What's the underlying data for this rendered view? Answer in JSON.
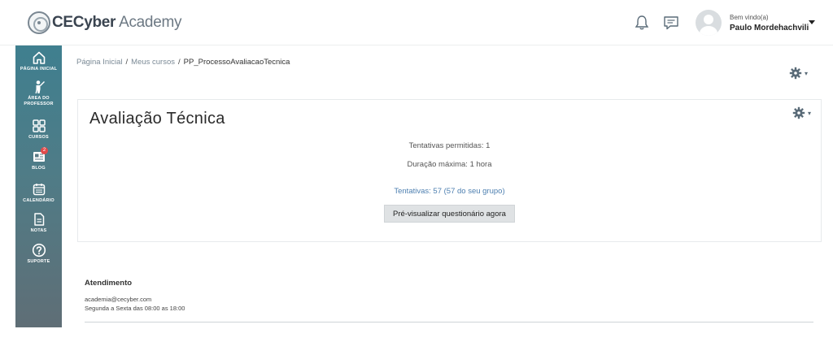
{
  "header": {
    "logo_strong": "CECyber",
    "logo_light": " Academy",
    "welcome": "Bem vindo(a)",
    "username": "Paulo Mordehachvili"
  },
  "sidebar": {
    "items": [
      {
        "label": "PÁGINA INICIAL",
        "icon": "home-icon"
      },
      {
        "label": "ÁREA DO PROFESSOR",
        "icon": "teacher-icon"
      },
      {
        "label": "CURSOS",
        "icon": "courses-grid-icon"
      },
      {
        "label": "BLOG",
        "icon": "blog-icon",
        "badge": "2"
      },
      {
        "label": "CALENDÁRIO",
        "icon": "calendar-icon"
      },
      {
        "label": "NOTAS",
        "icon": "notes-icon"
      },
      {
        "label": "SUPORTE",
        "icon": "help-icon"
      }
    ]
  },
  "breadcrumb": {
    "home": "Página Inicial",
    "courses": "Meus cursos",
    "current": "PP_ProcessoAvaliacaoTecnica",
    "separator": "/"
  },
  "quiz": {
    "title": "Avaliação Técnica",
    "allowed_attempts": "Tentativas permitidas: 1",
    "max_duration": "Duração máxima: 1 hora",
    "attempts_link": "Tentativas: 57 (57 do seu grupo)",
    "preview_button": "Pré-visualizar questionário agora"
  },
  "footer": {
    "title": "Atendimento",
    "email": "academia@cecyber.com",
    "hours": "Segunda a Sexta das 08:00 as 18:00"
  },
  "colors": {
    "sidebar_top": "#3f7f8f",
    "sidebar_bottom": "#5f6e76",
    "link": "#4d7fb0",
    "gear": "#5a6b78",
    "badge": "#e24b4b"
  }
}
